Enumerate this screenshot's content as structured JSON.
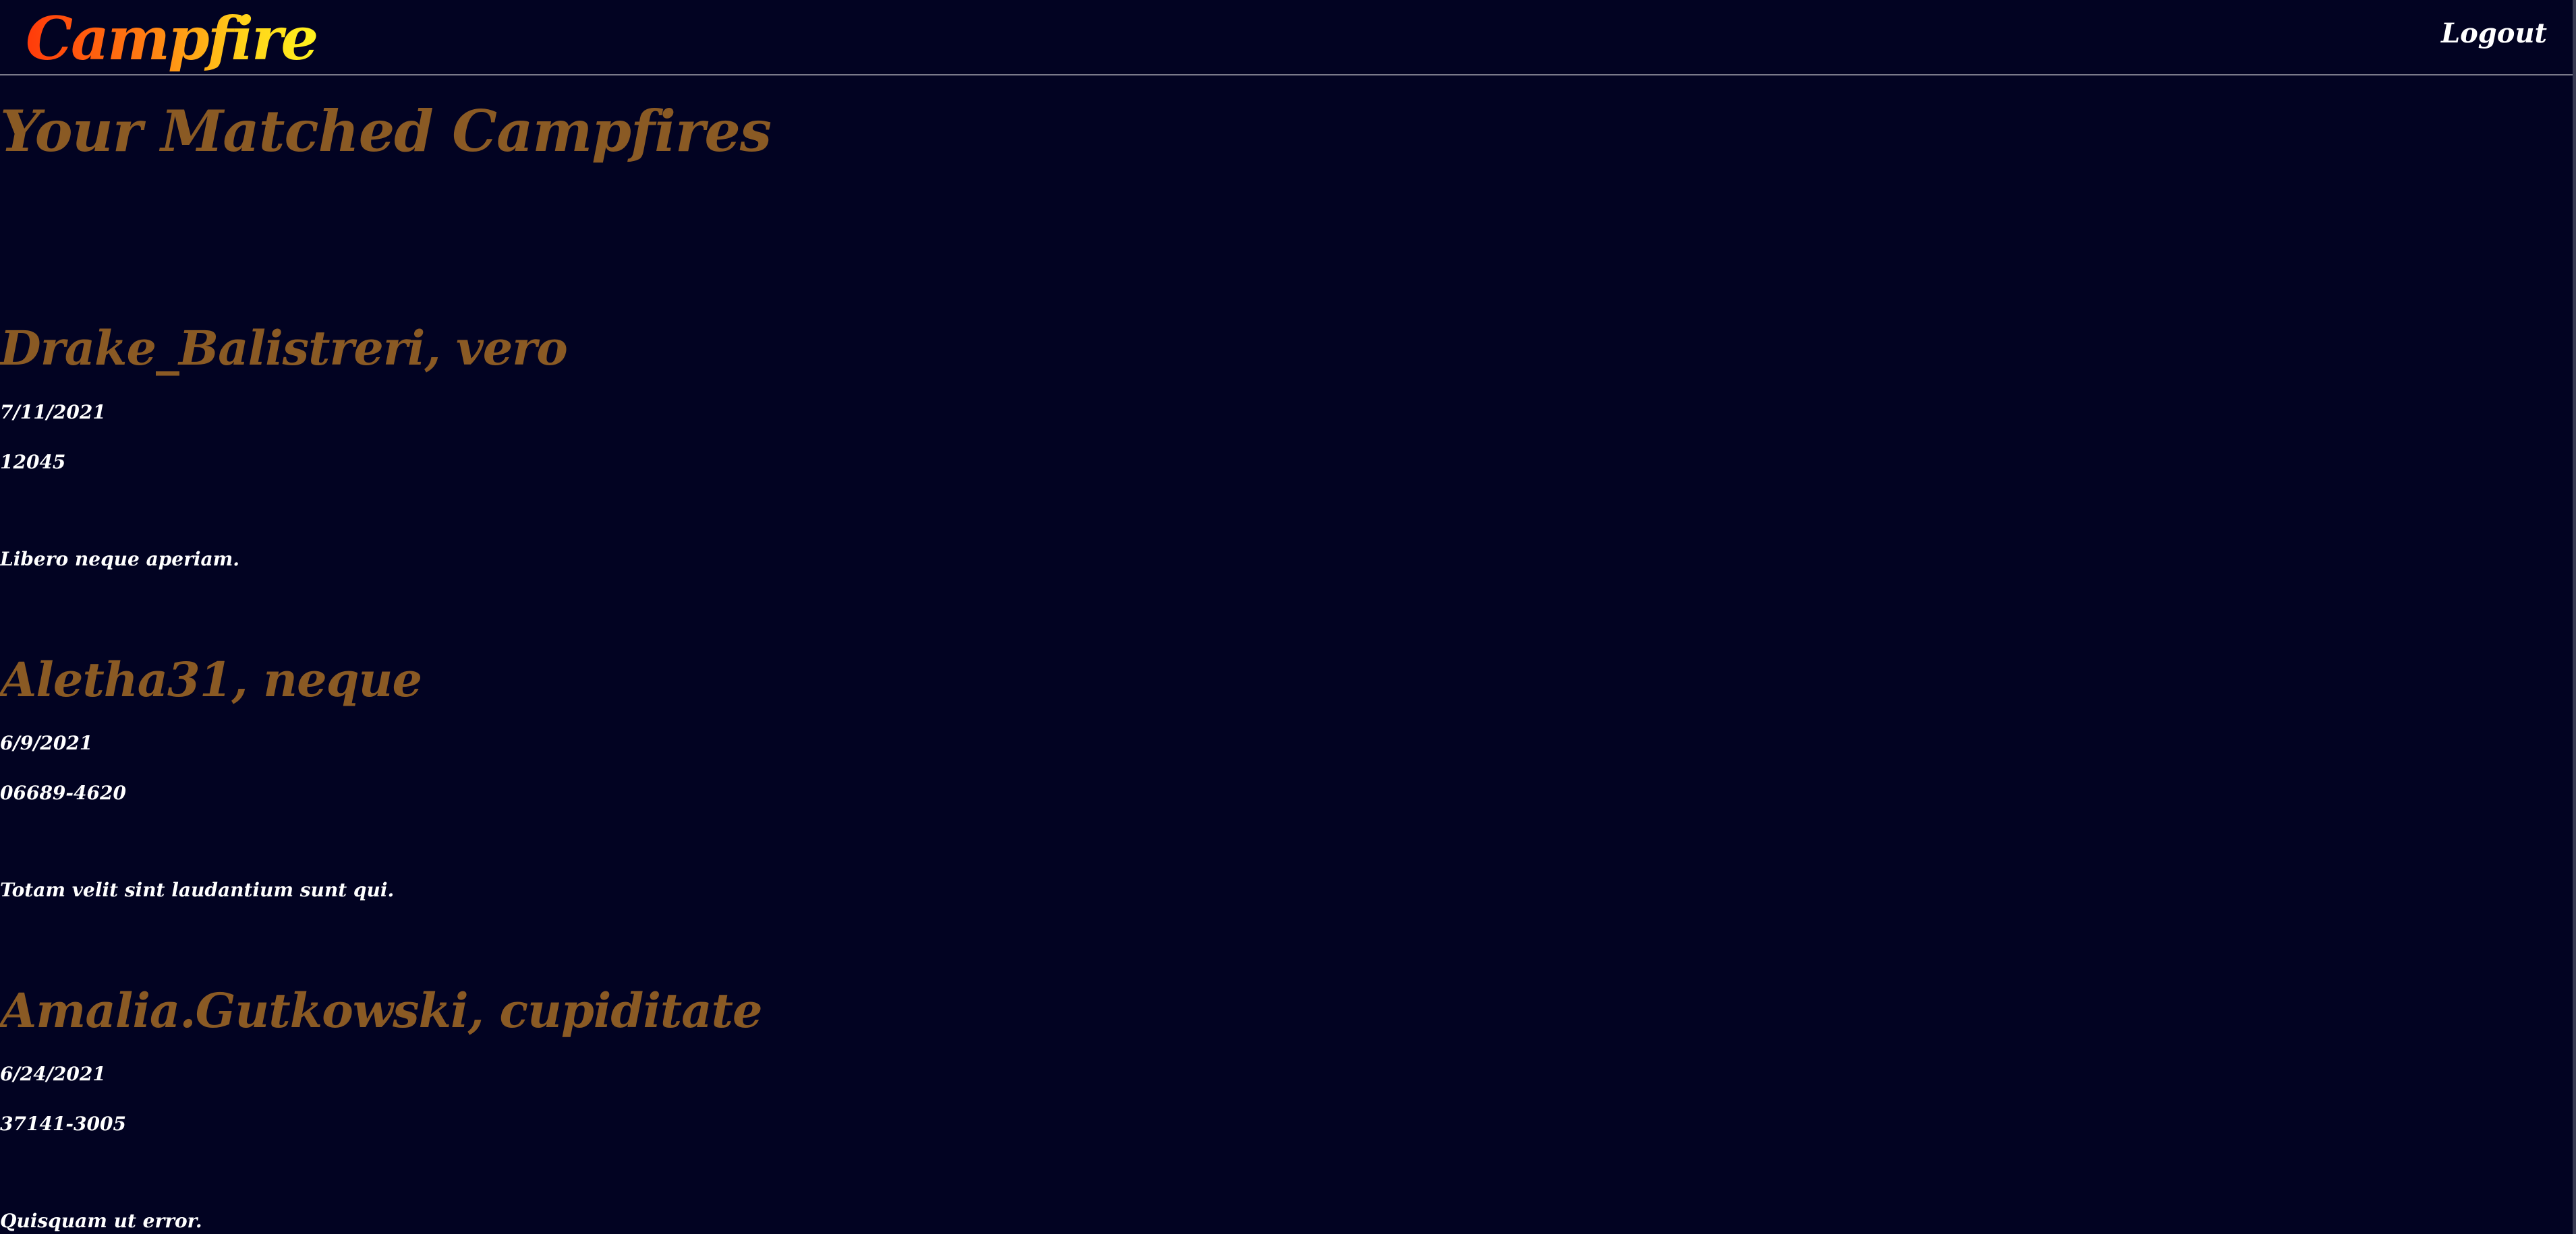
{
  "navbar": {
    "brand": "Campfire",
    "logout_label": "Logout"
  },
  "main": {
    "title": "Your Matched Campfires",
    "matches": [
      {
        "name": "Drake_Balistreri, vero",
        "date": "7/11/2021",
        "zip": "12045",
        "description": "Libero neque aperiam."
      },
      {
        "name": "Aletha31, neque",
        "date": "6/9/2021",
        "zip": "06689-4620",
        "description": "Totam velit sint laudantium sunt qui."
      },
      {
        "name": "Amalia.Gutkowski, cupiditate",
        "date": "6/24/2021",
        "zip": "37141-3005",
        "description": "Quisquam ut error."
      }
    ]
  },
  "colors": {
    "background": "#020322",
    "heading": "#8a5a24",
    "text": "#ffffff",
    "brand_gradient_start": "#ff3a0a",
    "brand_gradient_end": "#fff21e"
  }
}
